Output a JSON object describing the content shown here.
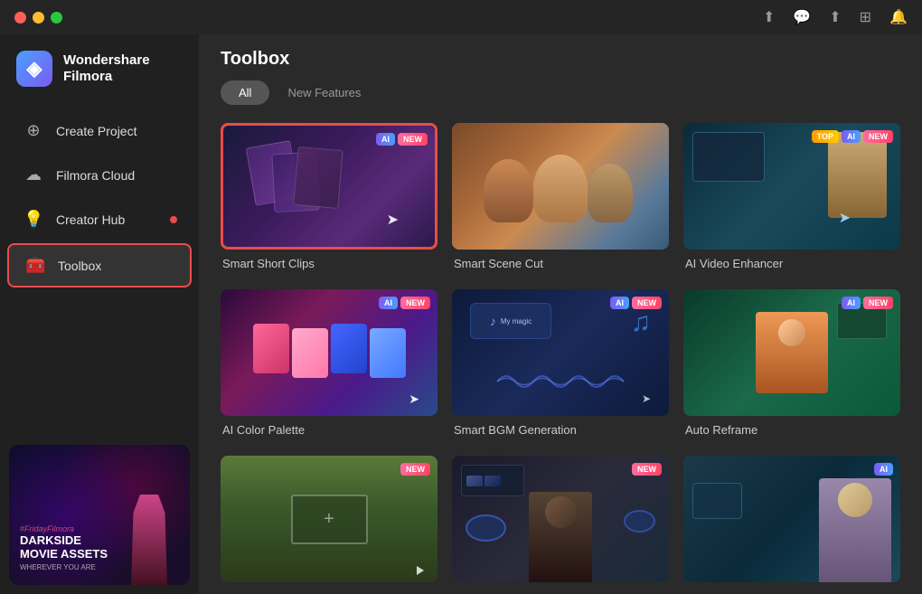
{
  "app": {
    "name": "Wondershare",
    "subname": "Filmora"
  },
  "titlebar": {
    "icons": [
      "share-icon",
      "chat-icon",
      "upload-icon",
      "grid-icon",
      "bell-icon"
    ]
  },
  "sidebar": {
    "logo": {
      "line1": "Wondershare",
      "line2": "Filmora"
    },
    "nav_items": [
      {
        "id": "create-project",
        "label": "Create Project",
        "icon": "plus-circle",
        "active": false,
        "badge": false
      },
      {
        "id": "filmora-cloud",
        "label": "Filmora Cloud",
        "icon": "cloud",
        "active": false,
        "badge": false
      },
      {
        "id": "creator-hub",
        "label": "Creator Hub",
        "icon": "lightbulb",
        "active": false,
        "badge": true
      },
      {
        "id": "toolbox",
        "label": "Toolbox",
        "icon": "toolbox",
        "active": true,
        "badge": false
      }
    ],
    "promo": {
      "hashtag": "#FridayFilmora",
      "title1": "DARKSIDE",
      "title2": "MOVIE ASSETS",
      "subtitle": "WHEREVER YOU ARE"
    }
  },
  "main": {
    "title": "Toolbox",
    "tabs": [
      {
        "id": "all",
        "label": "All",
        "active": true
      },
      {
        "id": "new-features",
        "label": "New Features",
        "active": false
      }
    ],
    "grid_items": [
      {
        "id": "smart-short-clips",
        "label": "Smart Short Clips",
        "badges": [
          "AI",
          "NEW"
        ],
        "selected": true,
        "thumb_type": "cards"
      },
      {
        "id": "smart-scene-cut",
        "label": "Smart Scene Cut",
        "badges": [],
        "selected": false,
        "thumb_type": "people"
      },
      {
        "id": "ai-video-enhancer",
        "label": "AI Video Enhancer",
        "badges": [
          "AI",
          "NEW"
        ],
        "selected": false,
        "thumb_type": "violin"
      },
      {
        "id": "ai-color-palette",
        "label": "AI Color Palette",
        "badges": [
          "AI",
          "NEW"
        ],
        "selected": false,
        "thumb_type": "color-collage"
      },
      {
        "id": "smart-bgm-generation",
        "label": "Smart BGM Generation",
        "badges": [
          "AI",
          "NEW"
        ],
        "selected": false,
        "thumb_type": "music"
      },
      {
        "id": "auto-reframe",
        "label": "Auto Reframe",
        "badges": [
          "AI",
          "NEW"
        ],
        "selected": false,
        "thumb_type": "reframe"
      },
      {
        "id": "item-7",
        "label": "",
        "badges": [
          "NEW"
        ],
        "selected": false,
        "thumb_type": "billboard"
      },
      {
        "id": "item-8",
        "label": "",
        "badges": [
          "NEW"
        ],
        "selected": false,
        "thumb_type": "dark-person"
      },
      {
        "id": "item-9",
        "label": "",
        "badges": [
          "AI"
        ],
        "selected": false,
        "thumb_type": "blonde-person"
      }
    ]
  }
}
